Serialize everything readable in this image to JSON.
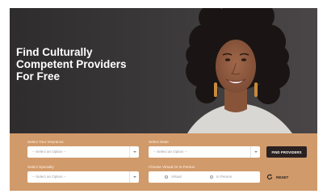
{
  "hero": {
    "title_lines": [
      "Find Culturally",
      "Competent Providers",
      "For Free"
    ]
  },
  "search": {
    "insurance": {
      "label": "Select Your Insurance",
      "placeholder": "-- Select an Option --"
    },
    "state": {
      "label": "Select State",
      "placeholder": "-- Select an Option --"
    },
    "specialty": {
      "label": "Select Specialty",
      "placeholder": "-- Select an Option --"
    },
    "mode": {
      "label": "Choose Virtual Or In Person",
      "options": [
        "Virtual",
        "In Person"
      ]
    },
    "find_button": "FIND PROVIDERS",
    "reset_label": "RESET"
  },
  "colors": {
    "hero_bg": "#3a3839",
    "panel_bg": "#d19a6a",
    "button_bg": "#2b2121"
  },
  "icons": {
    "select_caret": "chevron-down-icon",
    "reset": "refresh-icon"
  }
}
